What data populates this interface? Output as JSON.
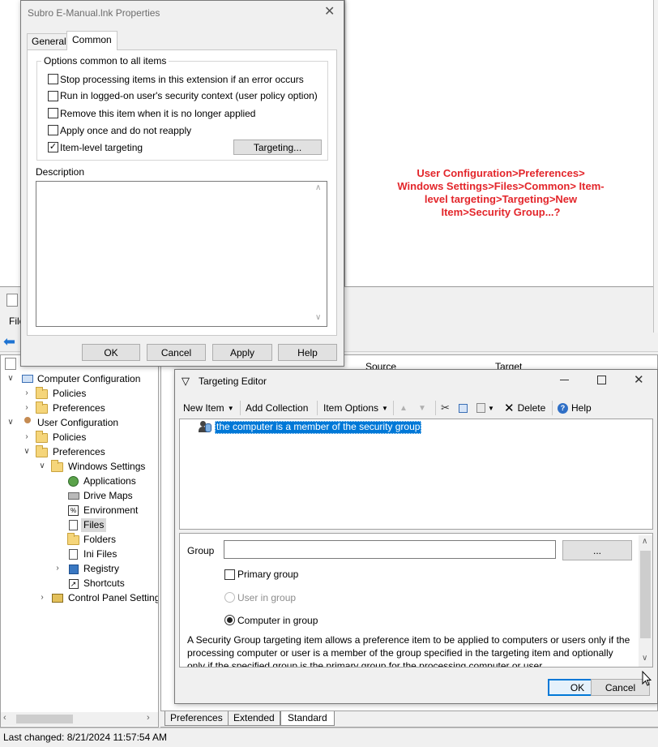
{
  "properties_dialog": {
    "title": "Subro E-Manual.lnk Properties",
    "tabs": [
      {
        "label": "General",
        "active": false
      },
      {
        "label": "Common",
        "active": true
      }
    ],
    "group_title": "Options common to all items",
    "options": [
      {
        "label": "Stop processing items in this extension if an error occurs",
        "checked": false
      },
      {
        "label": "Run in logged-on user's security context (user policy option)",
        "checked": false
      },
      {
        "label": "Remove this item when it is no longer applied",
        "checked": false
      },
      {
        "label": "Apply once and do not reapply",
        "checked": false
      },
      {
        "label": "Item-level targeting",
        "checked": true
      }
    ],
    "targeting_button": "Targeting...",
    "description_label": "Description",
    "description_value": "",
    "buttons": {
      "ok": "OK",
      "cancel": "Cancel",
      "apply": "Apply",
      "help": "Help"
    }
  },
  "annotation": {
    "text": "User Configuration>Preferences> Windows Settings>Files>Common> Item-level targeting>Targeting>New Item>Security Group...?",
    "color": "#e3262b"
  },
  "main_window": {
    "menu_partial": "File",
    "columns_partial": [
      "Source",
      "Target"
    ],
    "tree": [
      {
        "label": "Computer Configuration",
        "icon": "computer-config-icon"
      },
      {
        "label": "Policies",
        "icon": "folder-icon"
      },
      {
        "label": "Preferences",
        "icon": "folder-icon"
      },
      {
        "label": "User Configuration",
        "icon": "user-config-icon"
      },
      {
        "label": "Policies",
        "icon": "folder-icon"
      },
      {
        "label": "Preferences",
        "icon": "folder-icon"
      },
      {
        "label": "Windows Settings",
        "icon": "folder-icon"
      },
      {
        "label": "Applications",
        "icon": "applications-icon"
      },
      {
        "label": "Drive Maps",
        "icon": "drive-maps-icon"
      },
      {
        "label": "Environment",
        "icon": "environment-icon"
      },
      {
        "label": "Files",
        "icon": "files-icon",
        "selected": true
      },
      {
        "label": "Folders",
        "icon": "folder-icon"
      },
      {
        "label": "Ini Files",
        "icon": "ini-files-icon"
      },
      {
        "label": "Registry",
        "icon": "registry-icon"
      },
      {
        "label": "Shortcuts",
        "icon": "shortcuts-icon"
      },
      {
        "label": "Control Panel Settings",
        "icon": "control-panel-icon"
      }
    ],
    "bottom_tabs": [
      "Preferences",
      "Extended",
      "Standard"
    ],
    "status": "Last changed: 8/21/2024 11:57:54 AM"
  },
  "targeting_editor": {
    "title": "Targeting Editor",
    "toolbar": {
      "new_item": "New Item",
      "add_collection": "Add Collection",
      "item_options": "Item Options",
      "delete": "Delete",
      "help": "Help"
    },
    "items": [
      {
        "label": "the computer is a member of the security group",
        "selected": true
      }
    ],
    "group_label": "Group",
    "group_value": "",
    "browse_button": "...",
    "primary_group": {
      "label": "Primary group",
      "checked": false
    },
    "user_in_group": {
      "label": "User in group",
      "selected": false,
      "enabled": false
    },
    "computer_in_group": {
      "label": "Computer in group",
      "selected": true
    },
    "description": "A Security Group targeting item allows a preference item to be applied to computers or users only if the processing computer or user is a member of the group specified in the targeting item and optionally only if the specified group is the primary group for the processing computer or user.",
    "buttons": {
      "ok": "OK",
      "cancel": "Cancel"
    }
  }
}
